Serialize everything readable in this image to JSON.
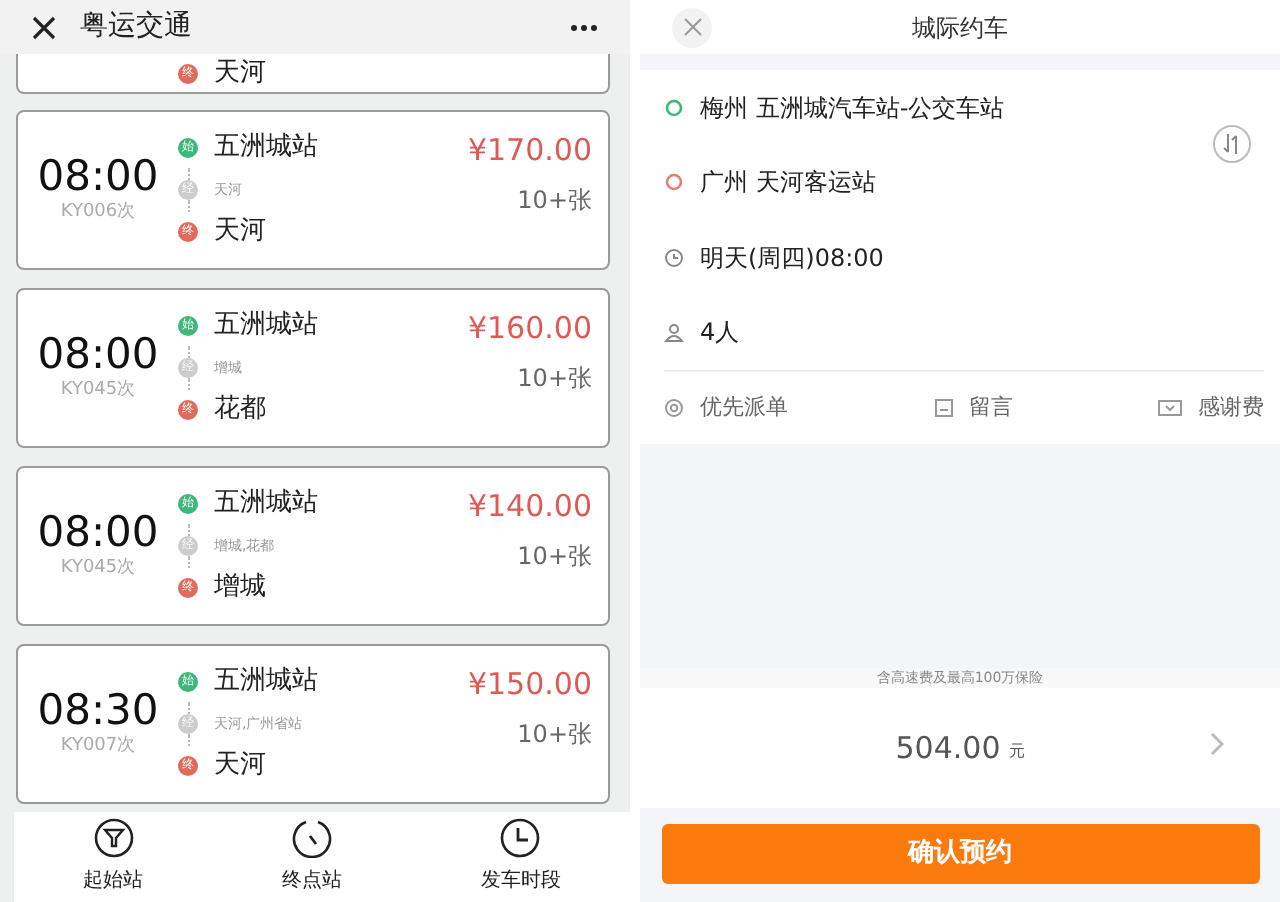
{
  "left": {
    "header": {
      "title": "粤运交通"
    },
    "trips": [
      {
        "kind": "partial",
        "end_badge": "终",
        "to": "天河"
      },
      {
        "kind": "full",
        "time": "08:00",
        "code": "KY006次",
        "start_badge": "始",
        "from": "五洲城站",
        "via_badge": "经",
        "via": "天河",
        "end_badge": "终",
        "to": "天河",
        "price": "¥170.00",
        "tickets": "10+张"
      },
      {
        "kind": "full",
        "time": "08:00",
        "code": "KY045次",
        "start_badge": "始",
        "from": "五洲城站",
        "via_badge": "经",
        "via": "增城",
        "end_badge": "终",
        "to": "花都",
        "price": "¥160.00",
        "tickets": "10+张"
      },
      {
        "kind": "full",
        "time": "08:00",
        "code": "KY045次",
        "start_badge": "始",
        "from": "五洲城站",
        "via_badge": "经",
        "via": "增城,花都",
        "end_badge": "终",
        "to": "增城",
        "price": "¥140.00",
        "tickets": "10+张"
      },
      {
        "kind": "full",
        "time": "08:30",
        "code": "KY007次",
        "start_badge": "始",
        "from": "五洲城站",
        "via_badge": "经",
        "via": "天河,广州省站",
        "end_badge": "终",
        "to": "天河",
        "price": "¥150.00",
        "tickets": "10+张"
      }
    ],
    "bottom_nav": [
      {
        "kind": "filter",
        "label": "起始站"
      },
      {
        "kind": "dial",
        "label": "终点站"
      },
      {
        "kind": "clock",
        "label": "发车时段"
      }
    ]
  },
  "right": {
    "header": {
      "title": "城际约车"
    },
    "route": [
      {
        "kind": "origin",
        "text": "梅州 五洲城汽车站-公交车站"
      },
      {
        "kind": "destination",
        "text": "广州 天河客运站"
      },
      {
        "kind": "time",
        "text": "明天(周四)08:00"
      },
      {
        "kind": "people",
        "text": "4人"
      }
    ],
    "options": [
      {
        "kind": "priority",
        "label": "优先派单"
      },
      {
        "kind": "message",
        "label": "留言"
      },
      {
        "kind": "tip",
        "label": "感谢费"
      }
    ],
    "note": "含高速费及最高100万保险",
    "price": {
      "amount": "504.00",
      "unit": "元"
    },
    "confirm_button": "确认预约"
  }
}
